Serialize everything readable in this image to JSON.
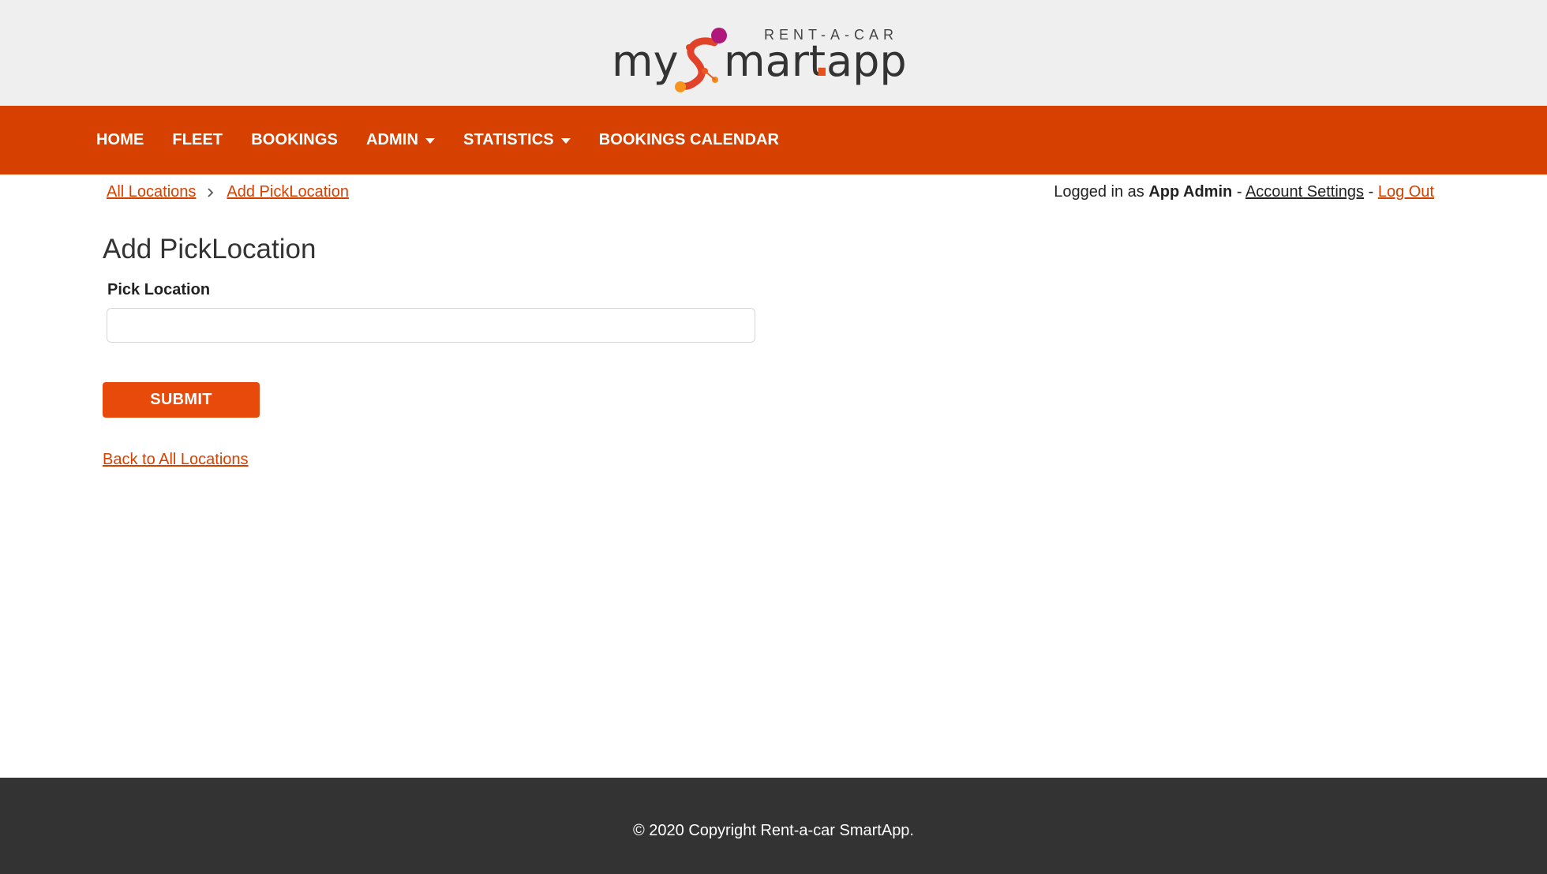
{
  "brand": {
    "logo_icon": "molecule-s-logo",
    "tagline": "RENT-A-CAR",
    "prefix": "my",
    "middle": "mart",
    "dot": ".",
    "suffix": "app",
    "colors": {
      "primary": "#d64000",
      "accent_pink": "#c2185b",
      "accent_orange": "#f7941d",
      "text_dark": "#333333"
    }
  },
  "nav": {
    "items": [
      {
        "label": "HOME",
        "has_dropdown": false
      },
      {
        "label": "FLEET",
        "has_dropdown": false
      },
      {
        "label": "BOOKINGS",
        "has_dropdown": false
      },
      {
        "label": "ADMIN",
        "has_dropdown": true
      },
      {
        "label": "STATISTICS",
        "has_dropdown": true
      },
      {
        "label": "BOOKINGS CALENDAR",
        "has_dropdown": false
      }
    ]
  },
  "breadcrumb": {
    "items": [
      "All Locations",
      "Add PickLocation"
    ],
    "separator_icon": "chevron-right-icon"
  },
  "user": {
    "prefix": "Logged in as",
    "name": "App Admin",
    "sep1": "-",
    "account_settings": "Account Settings",
    "sep2": "-",
    "logout": "Log Out"
  },
  "form": {
    "title": "Add PickLocation",
    "field_label": "Pick Location",
    "field_value": "",
    "field_placeholder": "",
    "submit_label": "SUBMIT",
    "back_link": "Back to All Locations"
  },
  "footer": {
    "copyright": "© 2020 Copyright Rent-a-car SmartApp."
  }
}
